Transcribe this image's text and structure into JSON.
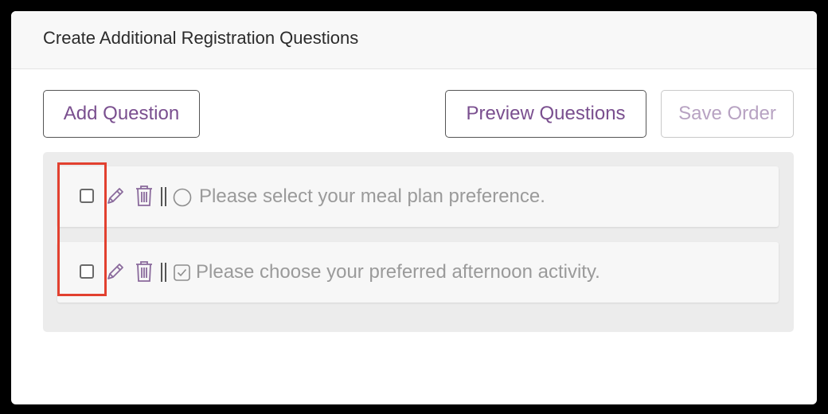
{
  "panel": {
    "title": "Create Additional Registration Questions"
  },
  "toolbar": {
    "add_label": "Add Question",
    "preview_label": "Preview Questions",
    "save_label": "Save Order"
  },
  "questions": [
    {
      "text": "Please select your meal plan preference.",
      "type_icon": "radio-circle-icon",
      "checked": false
    },
    {
      "text": "Please choose your preferred afternoon activity.",
      "type_icon": "checkbox-checked-icon",
      "checked": false
    }
  ],
  "colors": {
    "accent": "#7a4f8f",
    "highlight": "#e2402f"
  }
}
